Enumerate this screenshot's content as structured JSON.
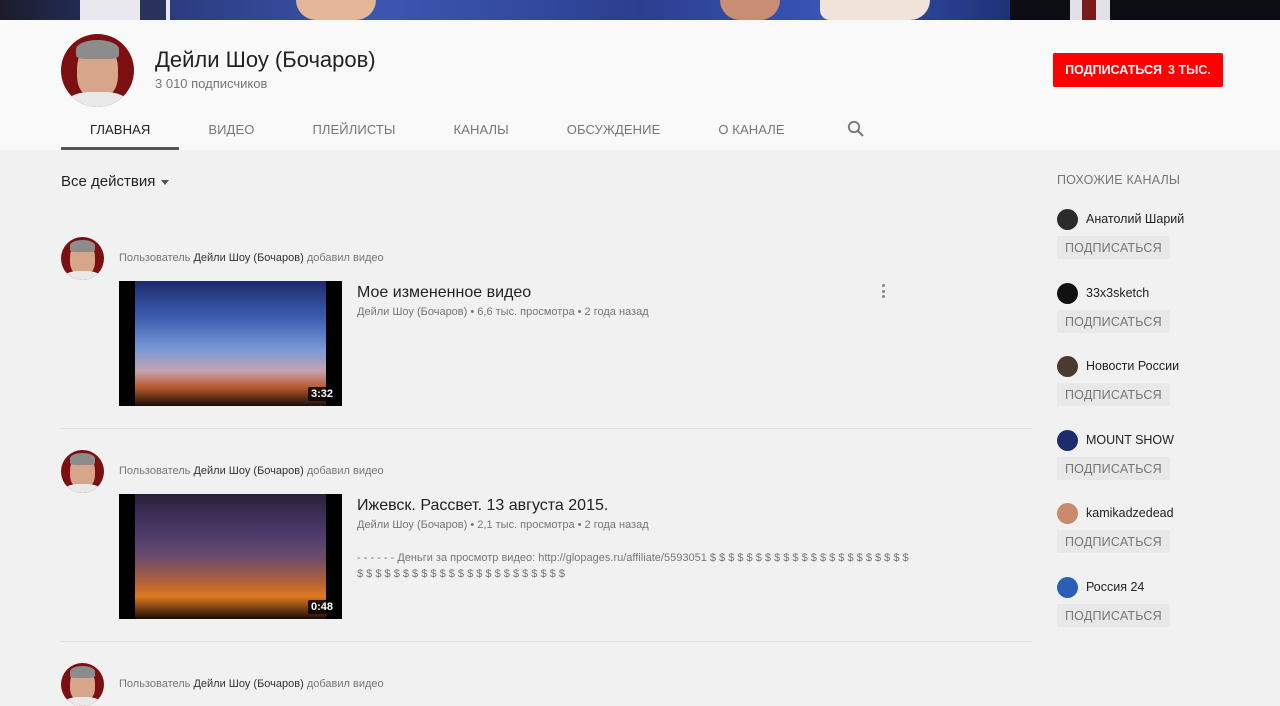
{
  "channel": {
    "title": "Дейли Шоу (Бочаров)",
    "subscribers": "3 010 подписчиков",
    "subscribe_label": "ПОДПИСАТЬСЯ",
    "subscribe_count": "3 ТЫС."
  },
  "tabs": [
    {
      "label": "ГЛАВНАЯ",
      "active": true
    },
    {
      "label": "ВИДЕО"
    },
    {
      "label": "ПЛЕЙЛИСТЫ"
    },
    {
      "label": "КАНАЛЫ"
    },
    {
      "label": "ОБСУЖДЕНИЕ"
    },
    {
      "label": "О КАНАЛЕ"
    }
  ],
  "filter": {
    "label": "Все действия"
  },
  "feed": [
    {
      "prefix": "Пользователь",
      "channel": "Дейли Шоу (Бочаров)",
      "action": "добавил видео",
      "title": "Мое измененное видео",
      "meta": "Дейли Шоу (Бочаров) • 6,6 тыс. просмотра • 2 года назад",
      "duration": "3:32",
      "description": ""
    },
    {
      "prefix": "Пользователь",
      "channel": "Дейли Шоу (Бочаров)",
      "action": "добавил видео",
      "title": "Ижевск. Рассвет. 13 августа 2015.",
      "meta": "Дейли Шоу (Бочаров) • 2,1 тыс. просмотра • 2 года назад",
      "duration": "0:48",
      "description": "- - - - - - Деньги за просмотр видео: http://glopages.ru/affiliate/5593051 $ $ $ $ $ $ $ $ $ $ $ $ $ $ $ $ $ $ $ $ $ $ $ $ $ $ $ $ $ $ $ $ $ $ $ $ $ $ $ $ $ $ $ $ $"
    },
    {
      "prefix": "Пользователь",
      "channel": "Дейли Шоу (Бочаров)",
      "action": "добавил видео"
    }
  ],
  "related": {
    "heading": "ПОХОЖИЕ КАНАЛЫ",
    "button_label": "ПОДПИСАТЬСЯ",
    "items": [
      {
        "name": "Анатолий Шарий",
        "avatar_color": "#2b2b2b"
      },
      {
        "name": "33x3sketch",
        "avatar_color": "#111111"
      },
      {
        "name": "Новости России",
        "avatar_color": "#4a3a30"
      },
      {
        "name": "MOUNT SHOW",
        "avatar_color": "#1d2d6b"
      },
      {
        "name": "kamikadzedead",
        "avatar_color": "#c98a6a"
      },
      {
        "name": "Россия 24",
        "avatar_color": "#2a5fb8"
      }
    ]
  },
  "colors": {
    "subscribe": "#ff0000",
    "avatar_bg": "#7b0f12"
  }
}
